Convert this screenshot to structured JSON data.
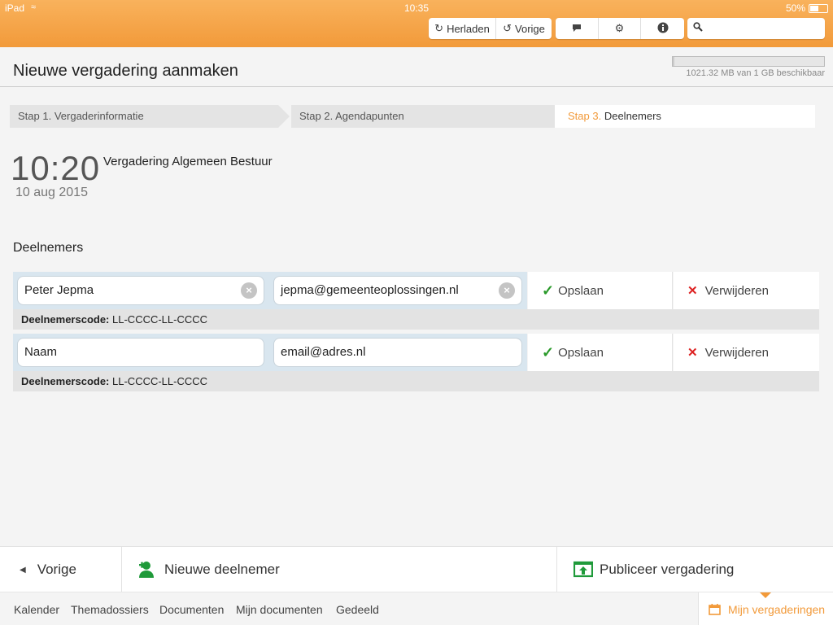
{
  "status_bar": {
    "carrier": "iPad",
    "time": "10:35",
    "battery": "50%"
  },
  "toolbar": {
    "reload_label": "Herladen",
    "back_label": "Vorige",
    "icons": [
      "comment-icon",
      "gear-icon",
      "info-icon"
    ],
    "search_placeholder": ""
  },
  "header": {
    "title": "Nieuwe vergadering aanmaken",
    "storage_text": "1021.32 MB van 1 GB beschikbaar"
  },
  "steps": [
    {
      "prefix": "Stap 1.",
      "label": "Vergaderinformatie",
      "active": false
    },
    {
      "prefix": "Stap 2.",
      "label": "Agendapunten",
      "active": false
    },
    {
      "prefix": "Stap 3.",
      "label": "Deelnemers",
      "active": true
    }
  ],
  "meeting": {
    "time": "10:20",
    "date": "10 aug 2015",
    "title": "Vergadering Algemeen Bestuur"
  },
  "participants_section": {
    "title": "Deelnemers",
    "code_label": "Deelnemerscode:",
    "save_label": "Opslaan",
    "delete_label": "Verwijderen"
  },
  "participants": [
    {
      "name": "Peter Jepma",
      "email": "jepma@gemeenteoplossingen.nl",
      "code": "LL-CCCC-LL-CCCC",
      "filled": true
    },
    {
      "name": "Naam",
      "email": "email@adres.nl",
      "code": "LL-CCCC-LL-CCCC",
      "filled": false
    }
  ],
  "actions": {
    "back_label": "Vorige",
    "new_participant_label": "Nieuwe deelnemer",
    "publish_label": "Publiceer vergadering"
  },
  "bottom_nav": {
    "items": [
      "Kalender",
      "Themadossiers",
      "Documenten",
      "Mijn documenten",
      "Gedeeld"
    ],
    "active": "Mijn vergaderingen"
  },
  "colors": {
    "accent": "#f29a3a",
    "save_check": "#2a9a2a",
    "delete_x": "#dd2222",
    "action_green": "#1f9a3a"
  }
}
